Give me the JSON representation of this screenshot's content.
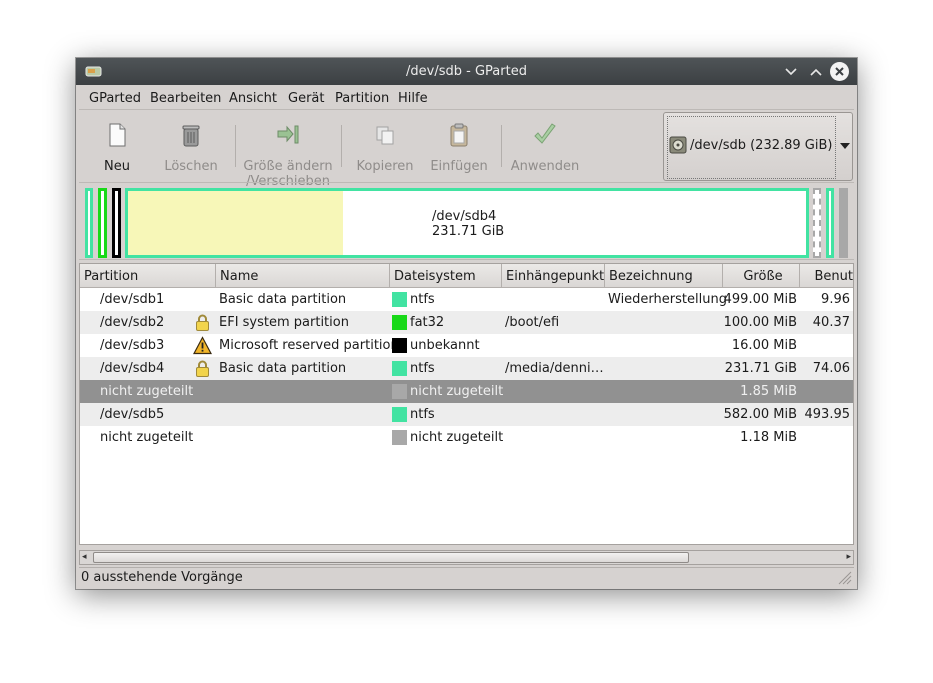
{
  "window": {
    "title": "/dev/sdb - GParted"
  },
  "menu": [
    "GParted",
    "Bearbeiten",
    "Ansicht",
    "Gerät",
    "Partition",
    "Hilfe"
  ],
  "toolbar": {
    "new": "Neu",
    "delete": "Löschen",
    "resize_line1": "Größe ändern",
    "resize_line2": "/Verschieben",
    "copy": "Kopieren",
    "paste": "Einfügen",
    "apply": "Anwenden"
  },
  "device": {
    "label": "/dev/sdb   (232.89 GiB)"
  },
  "diskmap": {
    "selected_name": "/dev/sdb4",
    "selected_size": "231.71 GiB"
  },
  "columns": [
    "Partition",
    "Name",
    "Dateisystem",
    "Einhängepunkt",
    "Bezeichnung",
    "Größe",
    "Benut"
  ],
  "rows": [
    {
      "partition": "/dev/sdb1",
      "name": "Basic data partition",
      "fs": "ntfs",
      "fs_color": "#42e3a2",
      "mount": "",
      "label": "Wiederherstellung",
      "size": "499.00 MiB",
      "used": "9.96",
      "icon": ""
    },
    {
      "partition": "/dev/sdb2",
      "name": "EFI system partition",
      "fs": "fat32",
      "fs_color": "#18d918",
      "mount": "/boot/efi",
      "label": "",
      "size": "100.00 MiB",
      "used": "40.37",
      "icon": "lock-icon"
    },
    {
      "partition": "/dev/sdb3",
      "name": "Microsoft reserved partition",
      "fs": "unbekannt",
      "fs_color": "#000000",
      "mount": "",
      "label": "",
      "size": "16.00 MiB",
      "used": "",
      "icon": "warning-icon"
    },
    {
      "partition": "/dev/sdb4",
      "name": "Basic data partition",
      "fs": "ntfs",
      "fs_color": "#42e3a2",
      "mount": "/media/denni…",
      "label": "",
      "size": "231.71 GiB",
      "used": "74.06",
      "icon": "lock-icon"
    },
    {
      "partition": "nicht zugeteilt",
      "name": "",
      "fs": "nicht zugeteilt",
      "fs_color": "#a8a8a8",
      "mount": "",
      "label": "",
      "size": "1.85 MiB",
      "used": "",
      "icon": ""
    },
    {
      "partition": "/dev/sdb5",
      "name": "",
      "fs": "ntfs",
      "fs_color": "#42e3a2",
      "mount": "",
      "label": "",
      "size": "582.00 MiB",
      "used": "493.95",
      "icon": ""
    },
    {
      "partition": "nicht zugeteilt",
      "name": "",
      "fs": "nicht zugeteilt",
      "fs_color": "#a8a8a8",
      "mount": "",
      "label": "",
      "size": "1.18 MiB",
      "used": "",
      "icon": ""
    }
  ],
  "status": {
    "text": "0 ausstehende Vorgänge"
  },
  "colors": {
    "ntfs": "#42e3a2",
    "fat32": "#18d918",
    "unknown": "#000000",
    "unallocated": "#a8a8a8",
    "selection": "#919191",
    "used_space": "#f7f7b8"
  }
}
